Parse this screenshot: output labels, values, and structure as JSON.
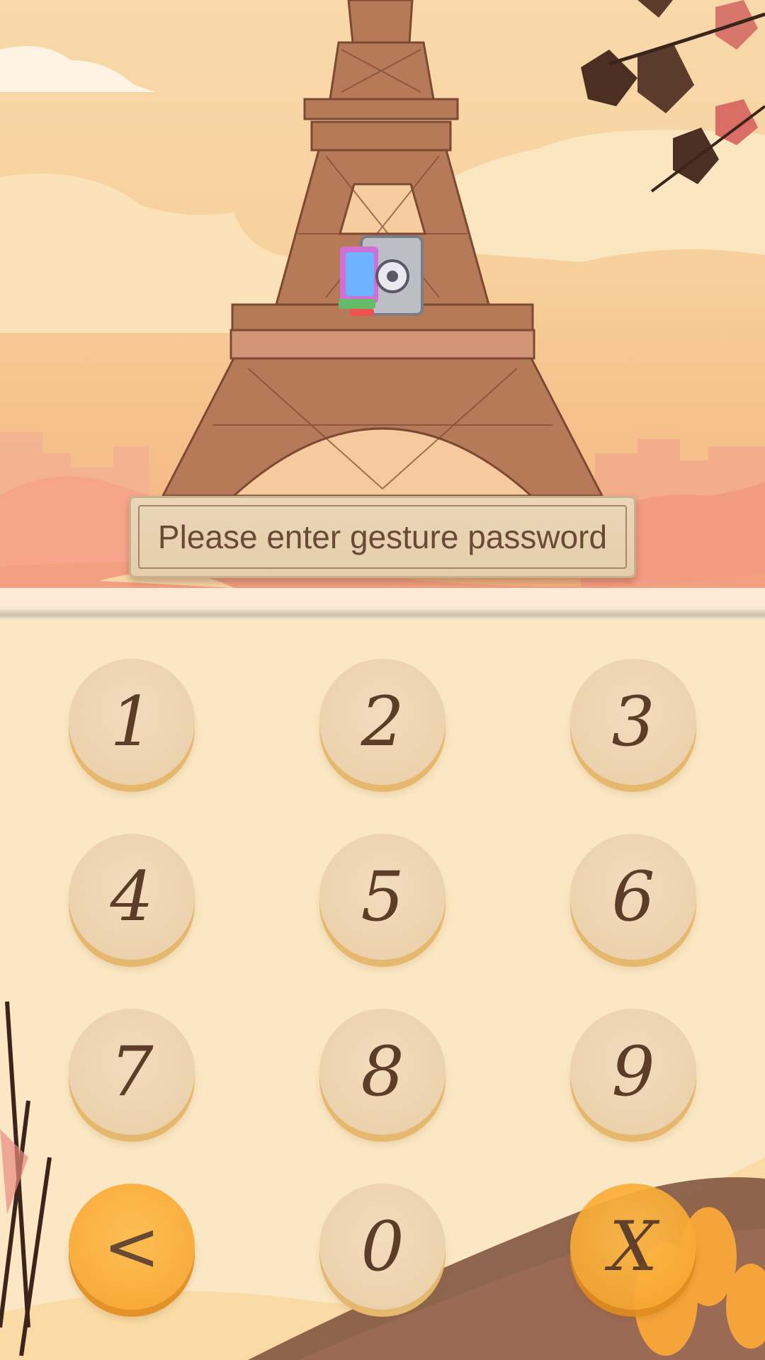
{
  "prompt": {
    "text": "Please enter gesture password"
  },
  "keypad": {
    "keys": [
      "1",
      "2",
      "3",
      "4",
      "5",
      "6",
      "7",
      "8",
      "9",
      "<",
      "0",
      "X"
    ]
  },
  "colors": {
    "accent": "#f8a932",
    "key_face": "#ecd2ae",
    "digit": "#5b3d28",
    "prompt_text": "#6a4a37"
  },
  "icons": {
    "app": "vault-safe-icon",
    "backspace": "back-arrow",
    "clear": "x-clear"
  }
}
